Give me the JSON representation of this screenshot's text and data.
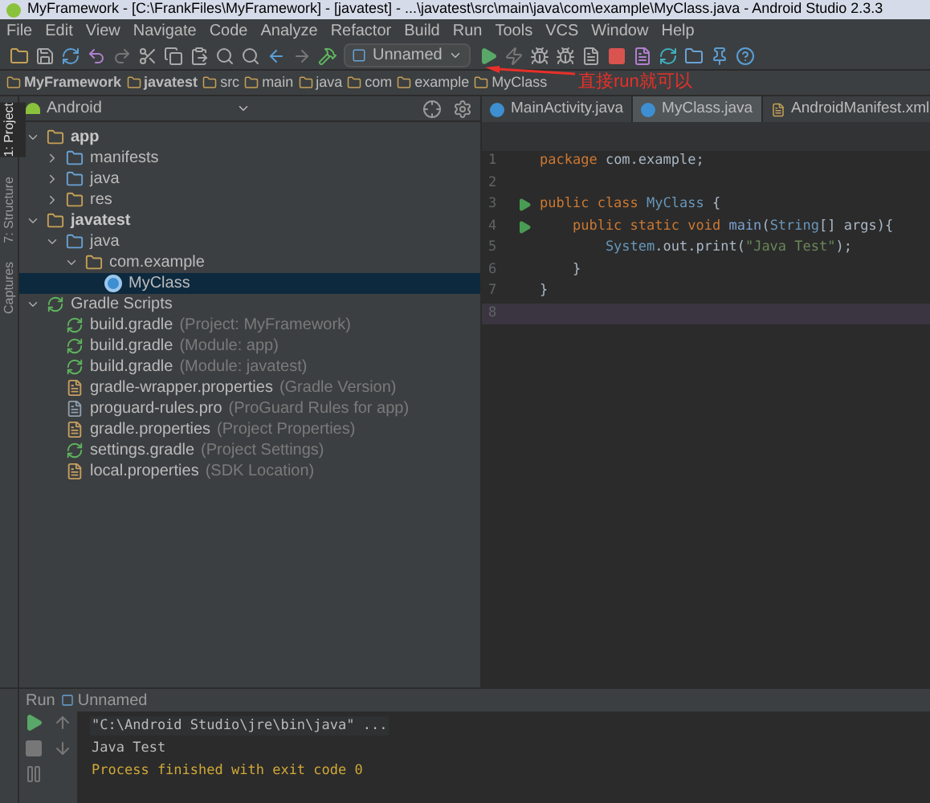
{
  "window": {
    "title": "MyFramework - [C:\\FrankFiles\\MyFramework] - [javatest] - ...\\javatest\\src\\main\\java\\com\\example\\MyClass.java - Android Studio 2.3.3"
  },
  "menu": [
    "File",
    "Edit",
    "View",
    "Navigate",
    "Code",
    "Analyze",
    "Refactor",
    "Build",
    "Run",
    "Tools",
    "VCS",
    "Window",
    "Help"
  ],
  "toolbar": {
    "run_config": "Unnamed"
  },
  "breadcrumb": [
    {
      "label": "MyFramework",
      "bold": true
    },
    {
      "label": "javatest",
      "bold": true
    },
    {
      "label": "src",
      "bold": false
    },
    {
      "label": "main",
      "bold": false
    },
    {
      "label": "java",
      "bold": false
    },
    {
      "label": "com",
      "bold": false
    },
    {
      "label": "example",
      "bold": false
    },
    {
      "label": "MyClass",
      "bold": false
    }
  ],
  "annotation": "直接run就可以",
  "side_tabs": [
    {
      "label": "1: Project",
      "selected": true
    },
    {
      "label": "7: Structure",
      "selected": false
    },
    {
      "label": "Captures",
      "selected": false
    }
  ],
  "project": {
    "view": "Android",
    "tree": [
      {
        "name": "app",
        "kind": "module",
        "expanded": true,
        "selected": false,
        "children": [
          {
            "name": "manifests",
            "kind": "folder",
            "expanded": false,
            "selected": false
          },
          {
            "name": "java",
            "kind": "folder",
            "expanded": false,
            "selected": false
          },
          {
            "name": "res",
            "kind": "resfolder",
            "expanded": false,
            "selected": false
          }
        ]
      },
      {
        "name": "javatest",
        "kind": "module",
        "expanded": true,
        "selected": false,
        "children": [
          {
            "name": "java",
            "kind": "folder",
            "expanded": true,
            "selected": false,
            "children": [
              {
                "name": "com.example",
                "kind": "package",
                "expanded": true,
                "selected": false,
                "children": [
                  {
                    "name": "MyClass",
                    "kind": "class",
                    "selected": true
                  }
                ]
              }
            ]
          }
        ]
      },
      {
        "name": "Gradle Scripts",
        "kind": "gradle-root",
        "expanded": true,
        "selected": false,
        "children": [
          {
            "name": "build.gradle",
            "hint": "(Project: MyFramework)",
            "kind": "gradle",
            "selected": false
          },
          {
            "name": "build.gradle",
            "hint": "(Module: app)",
            "kind": "gradle",
            "selected": false
          },
          {
            "name": "build.gradle",
            "hint": "(Module: javatest)",
            "kind": "gradle",
            "selected": false
          },
          {
            "name": "gradle-wrapper.properties",
            "hint": "(Gradle Version)",
            "kind": "properties",
            "selected": false
          },
          {
            "name": "proguard-rules.pro",
            "hint": "(ProGuard Rules for app)",
            "kind": "file",
            "selected": false
          },
          {
            "name": "gradle.properties",
            "hint": "(Project Properties)",
            "kind": "properties",
            "selected": false
          },
          {
            "name": "settings.gradle",
            "hint": "(Project Settings)",
            "kind": "gradle",
            "selected": false
          },
          {
            "name": "local.properties",
            "hint": "(SDK Location)",
            "kind": "properties",
            "selected": false
          }
        ]
      }
    ]
  },
  "editor_tabs": [
    {
      "label": "MainActivity.java",
      "kind": "class",
      "selected": false
    },
    {
      "label": "MyClass.java",
      "kind": "class",
      "selected": true
    },
    {
      "label": "AndroidManifest.xml",
      "kind": "xml",
      "selected": false
    }
  ],
  "code": [
    {
      "number": "1",
      "run": false,
      "current": false,
      "tokens": [
        {
          "text": "package",
          "kind": "keyword"
        },
        {
          "text": " com.example;",
          "kind": "plain"
        }
      ]
    },
    {
      "number": "2",
      "run": false,
      "current": false
    },
    {
      "number": "3",
      "run": true,
      "current": false,
      "tokens": [
        {
          "text": "public class ",
          "kind": "keyword"
        },
        {
          "text": "MyClass",
          "kind": "type"
        },
        {
          "text": " {",
          "kind": "plain"
        }
      ]
    },
    {
      "number": "4",
      "run": true,
      "current": false,
      "tokens": [
        {
          "text": "    public static void ",
          "kind": "keyword"
        },
        {
          "text": "main",
          "kind": "method"
        },
        {
          "text": "(",
          "kind": "plain"
        },
        {
          "text": "String",
          "kind": "type"
        },
        {
          "text": "[] args){",
          "kind": "plain"
        }
      ]
    },
    {
      "number": "5",
      "run": false,
      "current": false,
      "tokens": [
        {
          "text": "        System",
          "kind": "type"
        },
        {
          "text": ".out.print(",
          "kind": "plain"
        },
        {
          "text": "\"Java Test\"",
          "kind": "string"
        },
        {
          "text": ");",
          "kind": "plain"
        }
      ]
    },
    {
      "number": "6",
      "run": false,
      "current": false,
      "tokens": [
        {
          "text": "    }",
          "kind": "plain"
        }
      ]
    },
    {
      "number": "7",
      "run": false,
      "current": false,
      "tokens": [
        {
          "text": "}",
          "kind": "plain"
        }
      ]
    },
    {
      "number": "8",
      "run": false,
      "current": true
    }
  ],
  "run_panel": {
    "label": "Run",
    "config": "Unnamed",
    "output": [
      {
        "text": "\"C:\\Android Studio\\jre\\bin\\java\" ...",
        "kind": "command"
      },
      {
        "text": "Java Test",
        "kind": "stdout"
      },
      {
        "text": "Process finished with exit code 0",
        "kind": "system"
      }
    ]
  }
}
